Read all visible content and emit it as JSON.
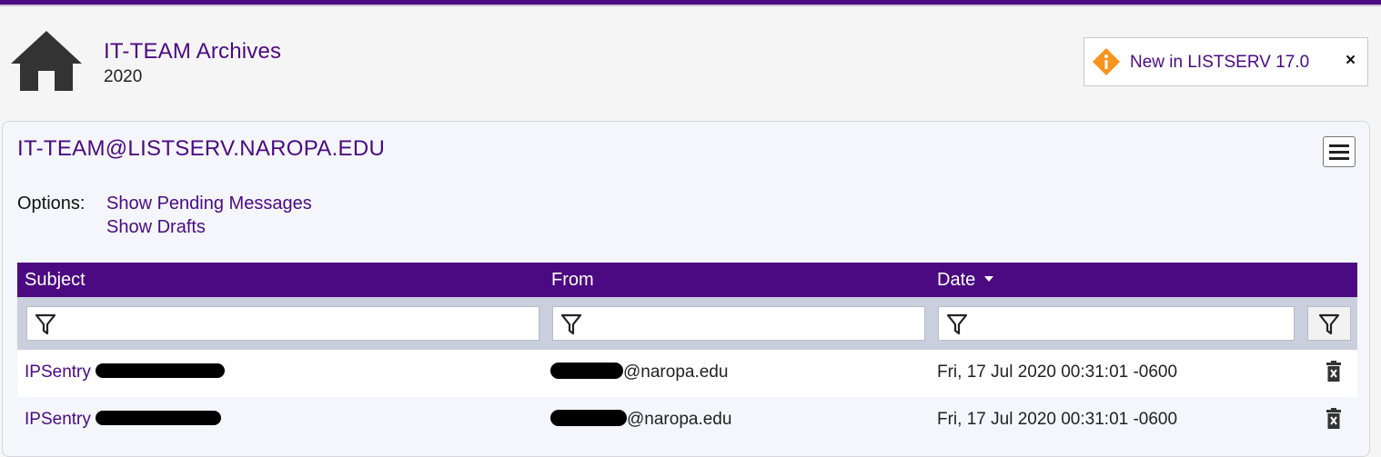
{
  "header": {
    "archive_title": "IT-TEAM Archives",
    "archive_year": "2020",
    "home_icon": "home-icon",
    "news": {
      "icon": "info-diamond-icon",
      "label": "New in LISTSERV 17.0",
      "close_label": "×"
    }
  },
  "colors": {
    "brand": "#4b0a82",
    "news_icon": "#f7941d"
  },
  "panel": {
    "list_address": "IT-TEAM@LISTSERV.NAROPA.EDU",
    "menu_icon": "hamburger-icon",
    "options_label": "Options:",
    "options": [
      "Show Pending Messages",
      "Show Drafts"
    ]
  },
  "table": {
    "columns": [
      "Subject",
      "From",
      "Date"
    ],
    "sort_column": "Date",
    "filters": {
      "subject": "",
      "from": "",
      "date": ""
    },
    "filter_icon": "funnel-icon",
    "rows": [
      {
        "subject": "IPSentry",
        "from": "@naropa.edu",
        "date": "Fri, 17 Jul 2020 00:31:01 -0600"
      },
      {
        "subject": "IPSentry",
        "from": "@naropa.edu",
        "date": "Fri, 17 Jul 2020 00:31:01 -0600"
      }
    ],
    "row_action_icon": "trash-icon"
  }
}
